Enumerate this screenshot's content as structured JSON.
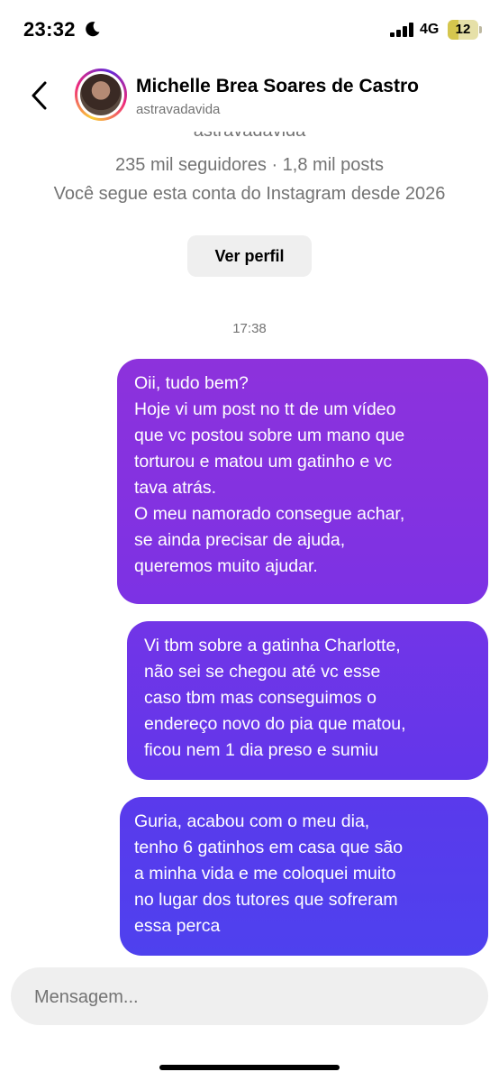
{
  "status_bar": {
    "time": "23:32",
    "network": "4G",
    "battery": "12"
  },
  "header": {
    "name": "Michelle Brea Soares de Castro",
    "handle": "astravadavida"
  },
  "profile_card": {
    "handle": "astravadavida",
    "followers": "235 mil seguidores · 1,8 mil posts",
    "follows_since": "Você segue esta conta do Instagram desde 2026",
    "view_profile_label": "Ver perfil"
  },
  "timestamp": "17:38",
  "messages": [
    {
      "lines": [
        "Oii, tudo bem?",
        "Hoje vi um post no tt de um vídeo",
        "que vc postou sobre um mano que",
        "torturou e matou um gatinho e vc",
        "tava atrás.",
        "O meu namorado consegue achar,",
        "se ainda precisar de ajuda,",
        "queremos muito ajudar."
      ]
    },
    {
      "lines": [
        "Vi tbm sobre a gatinha Charlotte,",
        "não sei se chegou até vc esse",
        "caso tbm mas conseguimos o",
        "endereço novo do pia que matou,",
        "ficou nem 1 dia preso e sumiu"
      ]
    },
    {
      "lines": [
        "Guria, acabou com o meu dia,",
        "tenho 6 gatinhos em casa que são",
        "a minha vida e me coloquei muito",
        "no lugar dos tutores que sofreram",
        "essa perca"
      ]
    }
  ],
  "composer": {
    "placeholder": "Mensagem..."
  },
  "colors": {
    "bubble_top": "#8d32dc",
    "bubble_bottom": "#4e41ee",
    "secondary_text": "#737373",
    "button_bg": "#efefef"
  }
}
